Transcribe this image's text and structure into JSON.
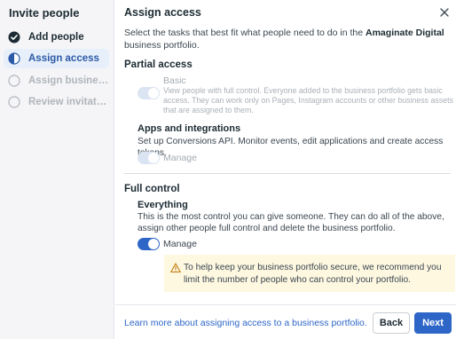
{
  "sidebar": {
    "title": "Invite people",
    "steps": [
      {
        "label": "Add people",
        "state": "done"
      },
      {
        "label": "Assign access",
        "state": "active"
      },
      {
        "label": "Assign business a...",
        "state": "pending"
      },
      {
        "label": "Review invitation",
        "state": "pending"
      }
    ]
  },
  "main": {
    "title": "Assign access",
    "intro_prefix": "Select the tasks that best fit what people need to do in the ",
    "intro_business": "Amaginate Digital",
    "intro_suffix": " business portfolio.",
    "partial": {
      "title": "Partial access",
      "basic_name": "Basic",
      "basic_desc": "View people with full control. Everyone added to the business portfolio gets basic access. They can work only on Pages, Instagram accounts or other business assets that are assigned to them.",
      "apps_title": "Apps and integrations",
      "apps_desc": "Set up Conversions API. Monitor events, edit applications and create access tokens.",
      "apps_toggle_label": "Manage"
    },
    "full": {
      "title": "Full control",
      "everything_title": "Everything",
      "everything_desc": "This is the most control you can give someone. They can do all of the above, assign other people full control and delete the business portfolio.",
      "toggle_label": "Manage",
      "warning": "To help keep your business portfolio secure, we recommend you limit the number of people who can control your portfolio."
    },
    "footer": {
      "learn_more": "Learn more about assigning access to a business portfolio.",
      "back_label": "Back",
      "next_label": "Next"
    }
  },
  "colors": {
    "accent": "#2d66c7",
    "warning_bg": "#fef8e1",
    "sidebar_bg": "#f5f5f7"
  }
}
